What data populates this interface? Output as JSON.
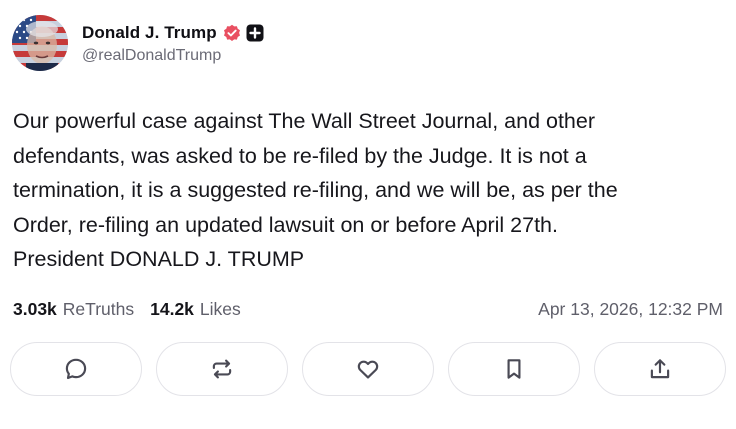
{
  "author": {
    "display_name": "Donald J. Trump",
    "handle": "@realDonaldTrump",
    "avatar_icon": "flag-portrait-avatar",
    "verified_icon": "verified-badge-icon",
    "verified_color": "#e94f61",
    "plus_badge_icon": "plus-badge-icon"
  },
  "post": {
    "lines": [
      "Our powerful case against The Wall Street Journal, and other",
      "defendants, was asked to be re-filed by the Judge. It is not a",
      "termination, it is a suggested re-filing, and we will be, as per the",
      "Order, re-filing an updated lawsuit on or before April 27th.",
      "President DONALD J. TRUMP"
    ]
  },
  "stats": {
    "retruths_count": "3.03k",
    "retruths_label": "ReTruths",
    "likes_count": "14.2k",
    "likes_label": "Likes",
    "timestamp": "Apr 13, 2026, 12:32 PM"
  },
  "actions": [
    {
      "name": "reply-button",
      "icon": "comment-icon"
    },
    {
      "name": "retruth-button",
      "icon": "repost-icon"
    },
    {
      "name": "like-button",
      "icon": "heart-icon"
    },
    {
      "name": "bookmark-button",
      "icon": "bookmark-icon"
    },
    {
      "name": "share-button",
      "icon": "share-icon"
    }
  ],
  "colors": {
    "text": "#17171c",
    "muted": "#5f5f6a",
    "border": "#e3e3e8",
    "icon": "#4a4a55"
  }
}
